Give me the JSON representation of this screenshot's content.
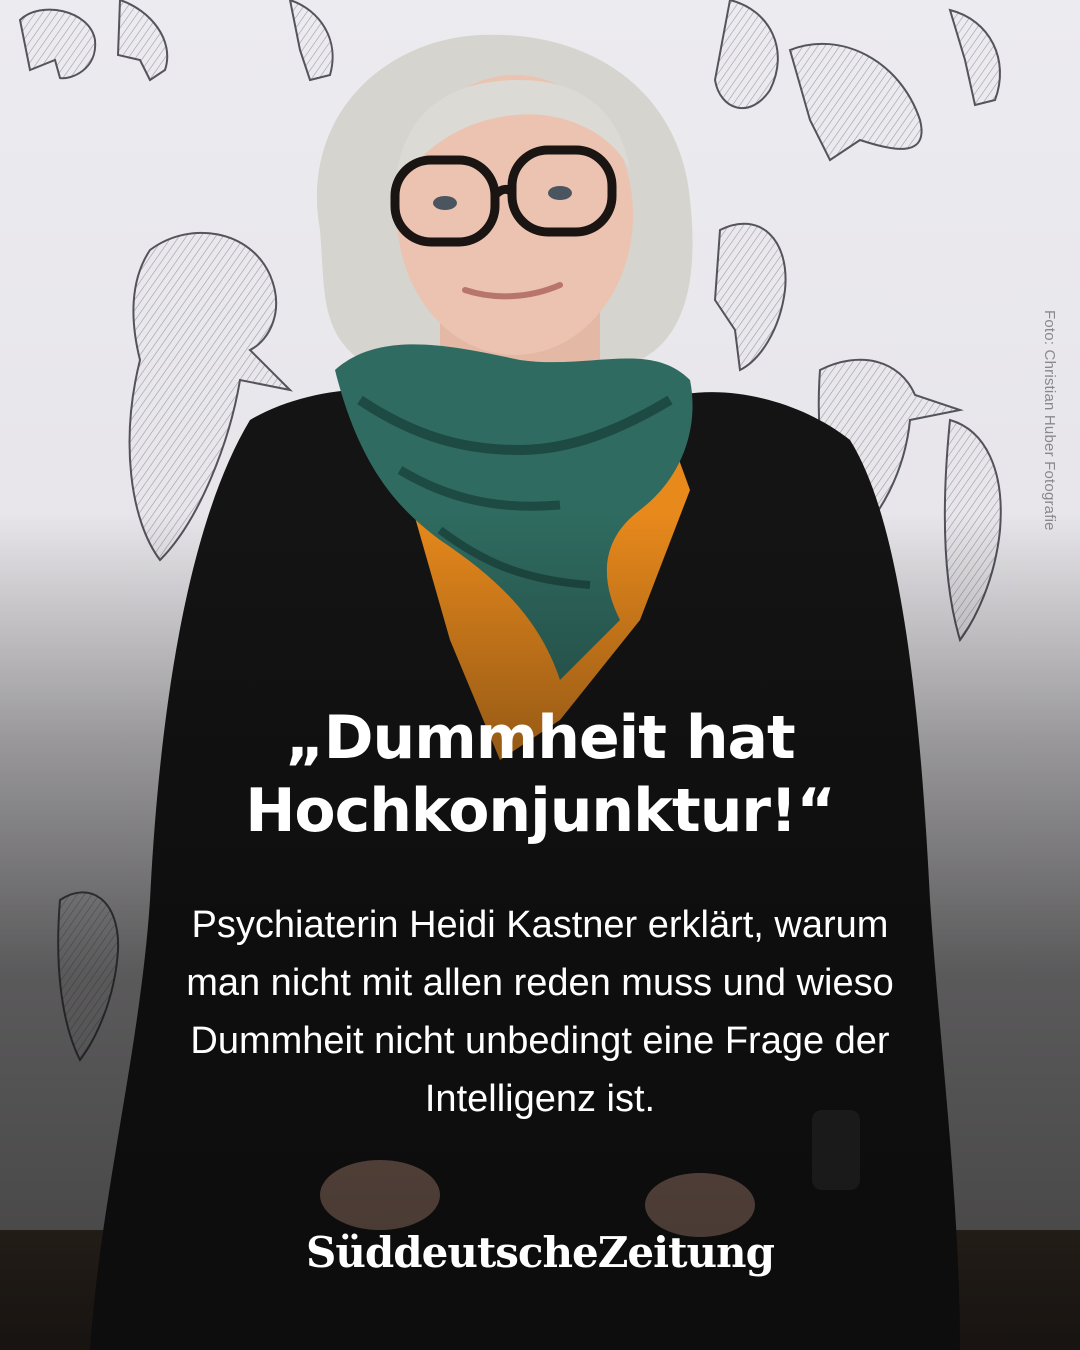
{
  "photo": {
    "credit": "Foto: Christian Huber Fotografie",
    "colors": {
      "wall": "#e9e7ea",
      "sweater": "#141414",
      "scarf_green": "#2f6b60",
      "scarf_orange": "#e8891c",
      "hair": "#d8d6d2"
    }
  },
  "post": {
    "headline_line1": "„Dummheit hat",
    "headline_line2": "Hochkonjunktur!“",
    "sub_line1": "Psychiaterin Heidi Kastner erklärt, warum",
    "sub_line2": "man nicht mit allen reden muss und wieso",
    "sub_line3": "Dummheit nicht unbedingt eine Frage der",
    "sub_line4": "Intelligenz ist.",
    "brand": "SüddeutscheZeitung"
  }
}
